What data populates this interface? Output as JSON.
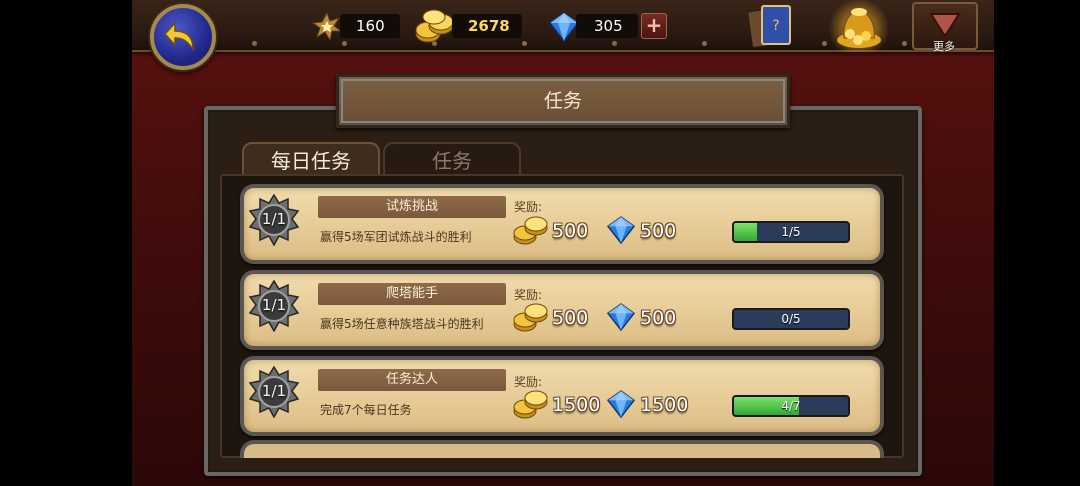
{
  "colors": {
    "accent_gold": "#f2c53d",
    "progress_green": "#2fa834",
    "progress_track": "#2b3c5a",
    "gem_blue": "#2a7be0"
  },
  "header": {
    "star_count": "160",
    "gold_count": "2678",
    "gem_count": "305",
    "more_label": "更多"
  },
  "panel": {
    "title": "任务",
    "tabs": [
      {
        "label": "每日任务",
        "active": true
      },
      {
        "label": "任务",
        "active": false
      }
    ]
  },
  "quests": [
    {
      "medal": "1/1",
      "title": "试炼挑战",
      "desc": "赢得5场军团试炼战斗的胜利",
      "reward_label": "奖励:",
      "gold": "500",
      "gems": "500",
      "progress_text": "1/5",
      "progress": 0.2
    },
    {
      "medal": "1/1",
      "title": "爬塔能手",
      "desc": "赢得5场任意种族塔战斗的胜利",
      "reward_label": "奖励:",
      "gold": "500",
      "gems": "500",
      "progress_text": "0/5",
      "progress": 0.0
    },
    {
      "medal": "1/1",
      "title": "任务达人",
      "desc": "完成7个每日任务",
      "reward_label": "奖励:",
      "gold": "1500",
      "gems": "1500",
      "progress_text": "4/7",
      "progress": 0.571
    }
  ]
}
